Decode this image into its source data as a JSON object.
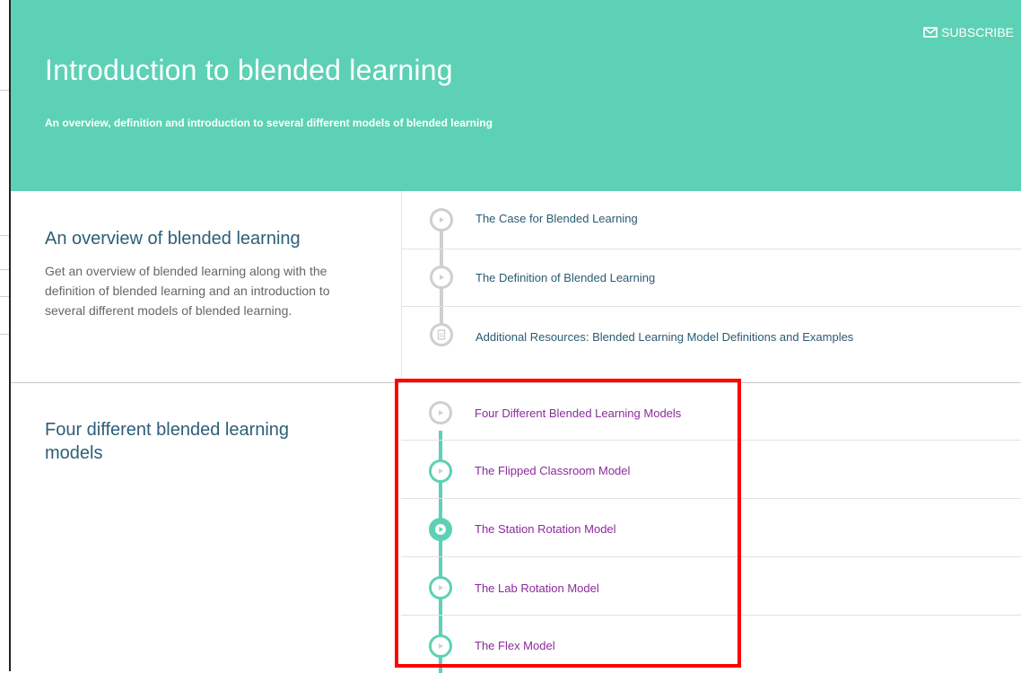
{
  "header": {
    "subscribe_label": "SUBSCRIBE",
    "title": "Introduction to blended learning",
    "subtitle": "An overview, definition and introduction to several different models of blended learning"
  },
  "sections": [
    {
      "title": "An overview of blended learning",
      "description": "Get an overview of blended learning along with the definition of blended learning and an introduction to several different models of blended learning.",
      "lessons": [
        {
          "label": "The Case for Blended Learning",
          "icon": "play-icon",
          "state": "not-started"
        },
        {
          "label": "The Definition of Blended Learning",
          "icon": "play-icon",
          "state": "not-started"
        },
        {
          "label": "Additional Resources: Blended Learning Model Definitions and Examples",
          "icon": "document-icon",
          "state": "not-started"
        }
      ]
    },
    {
      "title": "Four different blended learning models",
      "lessons": [
        {
          "label": "Four Different Blended Learning Models",
          "icon": "play-icon",
          "state": "not-started"
        },
        {
          "label": "The Flipped Classroom Model",
          "icon": "play-icon",
          "state": "in-progress"
        },
        {
          "label": "The Station Rotation Model",
          "icon": "play-icon",
          "state": "current"
        },
        {
          "label": "The Lab Rotation Model",
          "icon": "play-icon",
          "state": "in-progress"
        },
        {
          "label": "The Flex Model",
          "icon": "play-icon",
          "state": "in-progress"
        }
      ]
    }
  ],
  "colors": {
    "accent": "#5dd1b5",
    "section_title": "#2e5e78",
    "visited_link": "#8b2a9c",
    "highlight_box": "#ff0000"
  }
}
